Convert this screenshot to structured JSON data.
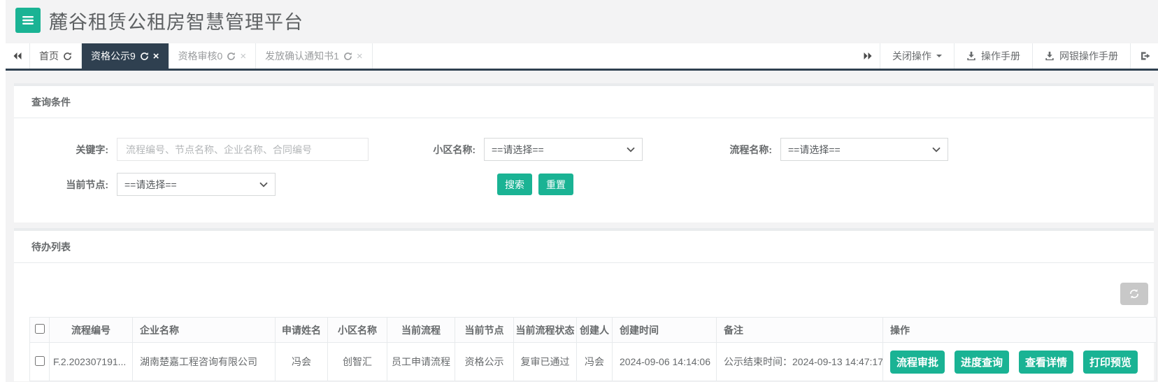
{
  "app": {
    "title": "麓谷租赁公租房智慧管理平台"
  },
  "tabbar": {
    "tabs": [
      {
        "label": "首页"
      },
      {
        "label": "资格公示9"
      },
      {
        "label": "资格审核0"
      },
      {
        "label": "发放确认通知书1"
      }
    ],
    "close_ops": "关闭操作",
    "op_manual": "操作手册",
    "bank_manual": "网银操作手册"
  },
  "query": {
    "title": "查询条件",
    "keyword_label": "关键字:",
    "keyword_placeholder": "流程编号、节点名称、企业名称、合同编号",
    "community_label": "小区名称:",
    "community_value": "==请选择==",
    "process_label": "流程名称:",
    "process_value": "==请选择==",
    "node_label": "当前节点:",
    "node_value": "==请选择==",
    "search": "搜索",
    "reset": "重置"
  },
  "todo": {
    "title": "待办列表",
    "columns": [
      "流程编号",
      "企业名称",
      "申请姓名",
      "小区名称",
      "当前流程",
      "当前节点",
      "当前流程状态",
      "创建人",
      "创建时间",
      "备注",
      "操作"
    ],
    "rows": [
      {
        "process_no": "F.2.202307191...",
        "company": "湖南楚嘉工程咨询有限公司",
        "applicant": "冯会",
        "community": "创智汇",
        "current_process": "员工申请流程",
        "current_node": "资格公示",
        "status": "复审已通过",
        "creator": "冯会",
        "created_at": "2024-09-06 14:14:06",
        "remark": "公示结束时间：2024-09-13 14:47:17",
        "actions": [
          "流程审批",
          "进度查询",
          "查看详情",
          "打印预览"
        ]
      }
    ]
  },
  "icons": {
    "menu": "hamburger-icon",
    "tab_refresh": "refresh-icon",
    "tab_close": "close-icon",
    "collapse": "double-chevron-left-icon",
    "expand": "double-chevron-right-icon",
    "dropdown": "caret-down-icon",
    "download": "download-icon",
    "logout": "sign-out-icon",
    "list_refresh": "refresh-icon",
    "select_arrow": "chevron-down-icon"
  },
  "colors": {
    "primary": "#1ab394",
    "tab_active_bg": "#2f4050",
    "page_bg": "#f3f3f4",
    "panel_border": "#e7eaec",
    "text": "#676a6c"
  }
}
